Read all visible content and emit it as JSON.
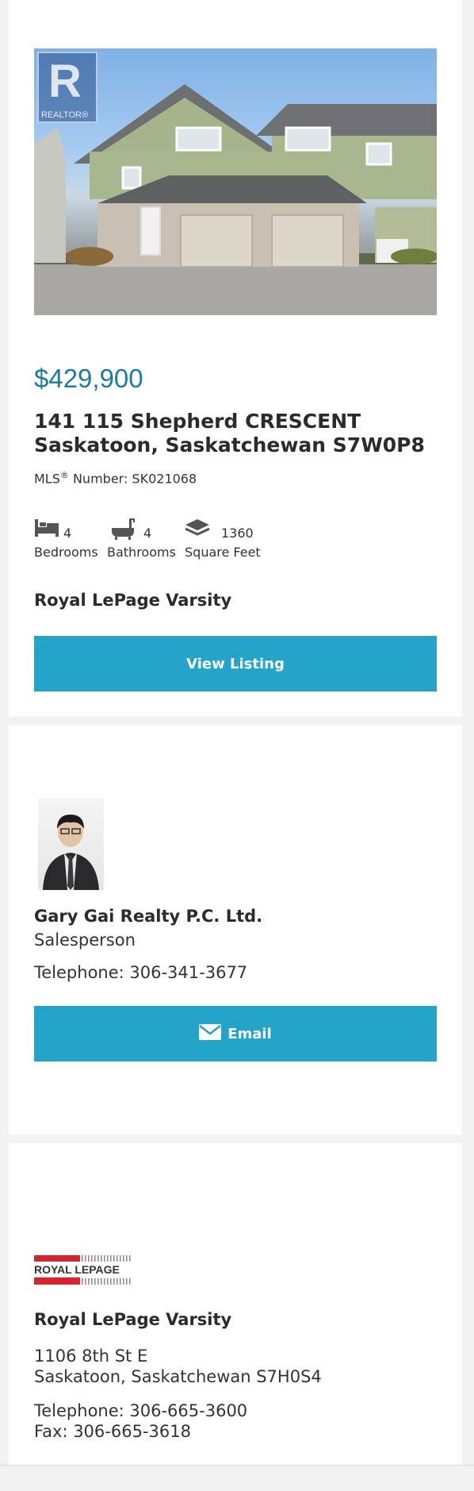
{
  "listing": {
    "price": "$429,900",
    "address_line1": "141 115 Shepherd CRESCENT",
    "address_line2": "Saskatoon, Saskatchewan S7W0P8",
    "mls_prefix": "MLS",
    "mls_sup": "®",
    "mls_suffix": " Number: SK021068",
    "photo_badge_letter": "R",
    "photo_badge_text": "REALTOR®",
    "specs": [
      {
        "icon": "bed-icon",
        "value": "4",
        "label": "Bedrooms"
      },
      {
        "icon": "bathtub-icon",
        "value": "4",
        "label": "Bathrooms"
      },
      {
        "icon": "area-icon",
        "value": "1360",
        "label": "Square Feet"
      }
    ],
    "brokerage": "Royal LePage Varsity",
    "view_button": "View Listing"
  },
  "agent": {
    "name": "Gary Gai Realty P.C. Ltd.",
    "title": "Salesperson",
    "telephone": "Telephone: 306-341-3677",
    "email_button": "Email"
  },
  "office": {
    "logo_text": "ROYAL LEPAGE",
    "name": "Royal LePage Varsity",
    "street": "1106 8th St E",
    "city": "Saskatoon, Saskatchewan S7H0S4",
    "telephone": "Telephone: 306-665-3600",
    "fax": "Fax: 306-665-3618"
  },
  "colors": {
    "accent": "#24a4c9",
    "price": "#1d7aa3",
    "logo_red": "#d7232e"
  }
}
